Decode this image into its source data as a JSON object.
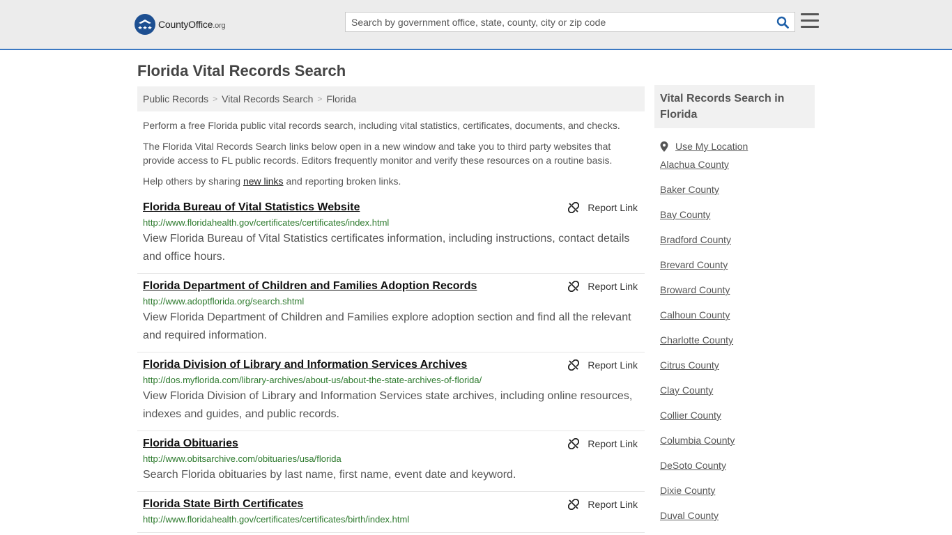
{
  "header": {
    "logo_county": "County",
    "logo_office": "Office",
    "logo_tld": ".org",
    "search_placeholder": "Search by government office, state, county, city or zip code"
  },
  "page_title": "Florida Vital Records Search",
  "breadcrumb": [
    "Public Records",
    "Vital Records Search",
    "Florida"
  ],
  "intro": {
    "p1": "Perform a free Florida public vital records search, including vital statistics, certificates, documents, and checks.",
    "p2": "The Florida Vital Records Search links below open in a new window and take you to third party websites that provide access to FL public records. Editors frequently monitor and verify these resources on a routine basis.",
    "p3_before": "Help others by sharing ",
    "p3_link": "new links",
    "p3_after": " and reporting broken links."
  },
  "report_label": "Report Link",
  "results": [
    {
      "title": "Florida Bureau of Vital Statistics Website",
      "url": "http://www.floridahealth.gov/certificates/certificates/index.html",
      "desc": "View Florida Bureau of Vital Statistics certificates information, including instructions, contact details and office hours."
    },
    {
      "title": "Florida Department of Children and Families Adoption Records",
      "url": "http://www.adoptflorida.org/search.shtml",
      "desc": "View Florida Department of Children and Families explore adoption section and find all the relevant and required information."
    },
    {
      "title": "Florida Division of Library and Information Services Archives",
      "url": "http://dos.myflorida.com/library-archives/about-us/about-the-state-archives-of-florida/",
      "desc": "View Florida Division of Library and Information Services state archives, including online resources, indexes and guides, and public records."
    },
    {
      "title": "Florida Obituaries",
      "url": "http://www.obitsarchive.com/obituaries/usa/florida",
      "desc": "Search Florida obituaries by last name, first name, event date and keyword."
    },
    {
      "title": "Florida State Birth Certificates",
      "url": "http://www.floridahealth.gov/certificates/certificates/birth/index.html",
      "desc": ""
    }
  ],
  "sidebar": {
    "heading": "Vital Records Search in Florida",
    "use_location": "Use My Location",
    "counties": [
      "Alachua County",
      "Baker County",
      "Bay County",
      "Bradford County",
      "Brevard County",
      "Broward County",
      "Calhoun County",
      "Charlotte County",
      "Citrus County",
      "Clay County",
      "Collier County",
      "Columbia County",
      "DeSoto County",
      "Dixie County",
      "Duval County"
    ]
  },
  "colors": {
    "accent_blue": "#3b78c2",
    "logo_blue": "#1d4f91",
    "url_green": "#2d7a2d"
  }
}
